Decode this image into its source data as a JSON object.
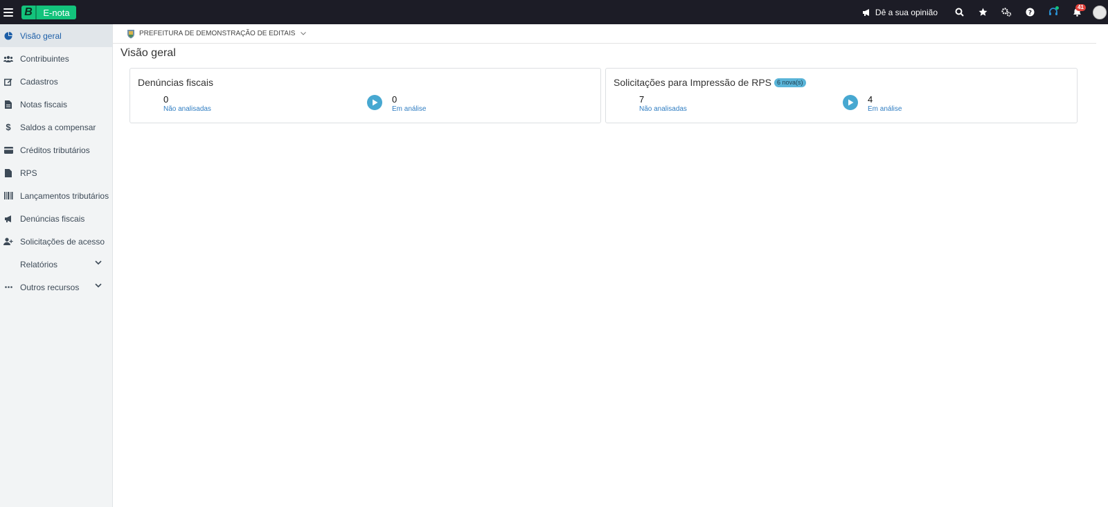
{
  "app": {
    "logo_letter": "B",
    "logo_name": "E-nota",
    "brand_color": "#13c37c"
  },
  "topbar": {
    "feedback_label": "Dê a sua opinião",
    "notification_count": "41",
    "icons": [
      "search-icon",
      "star-icon",
      "cogs-icon",
      "help-icon",
      "headset-icon",
      "bell-icon"
    ]
  },
  "sidebar": {
    "items": [
      {
        "label": "Visão geral",
        "icon": "chart-pie-icon",
        "active": true
      },
      {
        "label": "Contribuintes",
        "icon": "users-icon"
      },
      {
        "label": "Cadastros",
        "icon": "edit-icon"
      },
      {
        "label": "Notas fiscais",
        "icon": "file-text-icon"
      },
      {
        "label": "Saldos a compensar",
        "icon": "dollar-icon"
      },
      {
        "label": "Créditos tributários",
        "icon": "credit-card-icon"
      },
      {
        "label": "RPS",
        "icon": "file-icon"
      },
      {
        "label": "Lançamentos tributários",
        "icon": "barcode-icon"
      },
      {
        "label": "Denúncias fiscais",
        "icon": "bullhorn-icon"
      },
      {
        "label": "Solicitações de acesso",
        "icon": "user-plus-icon"
      },
      {
        "label": "Relatórios",
        "icon": "",
        "expandable": true
      },
      {
        "label": "Outros recursos",
        "icon": "ellipsis-icon",
        "expandable": true
      }
    ]
  },
  "breadcrumb": {
    "label": "PREFEITURA DE DEMONSTRAÇÃO DE EDITAIS"
  },
  "page": {
    "title": "Visão geral"
  },
  "cards": [
    {
      "title": "Denúncias fiscais",
      "badge": "",
      "stat1": {
        "value": "0",
        "label": "Não analisadas"
      },
      "stat2": {
        "value": "0",
        "label": "Em análise"
      }
    },
    {
      "title": "Solicitações para Impressão de RPS",
      "badge": "6 nova(s)",
      "stat1": {
        "value": "7",
        "label": "Não analisadas"
      },
      "stat2": {
        "value": "4",
        "label": "Em análise"
      }
    }
  ]
}
